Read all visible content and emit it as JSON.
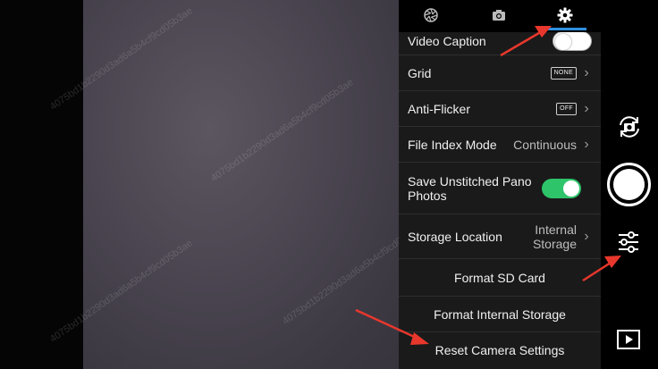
{
  "tabs": [
    {
      "name": "aperture-icon"
    },
    {
      "name": "camera-icon"
    },
    {
      "name": "gear-icon",
      "active": true
    }
  ],
  "settings": {
    "video_caption": {
      "label": "Video Caption",
      "toggle": "off"
    },
    "grid": {
      "label": "Grid",
      "value": "NONE"
    },
    "anti_flicker": {
      "label": "Anti-Flicker",
      "value": "OFF"
    },
    "file_index_mode": {
      "label": "File Index Mode",
      "value": "Continuous"
    },
    "save_unstitched": {
      "label": "Save Unstitched Pano Photos",
      "toggle": "on"
    },
    "storage_location": {
      "label": "Storage Location",
      "value": "Internal Storage"
    },
    "format_sd": {
      "label": "Format SD Card"
    },
    "format_internal": {
      "label": "Format Internal Storage"
    },
    "reset_camera": {
      "label": "Reset Camera Settings"
    }
  },
  "right_controls": {
    "switch_camera": "camera-switch-icon",
    "shutter": "shutter-button",
    "adjust": "sliders-icon",
    "playback": "play-icon"
  },
  "watermark_text": "4075bd1b2290d3ad6a5b4cf9cd05b3ae",
  "colors": {
    "accent": "#2f8fe0",
    "toggle_on": "#2ec46a",
    "annotation_arrow": "#e8372c",
    "panel_bg": "#1a1a1a"
  }
}
